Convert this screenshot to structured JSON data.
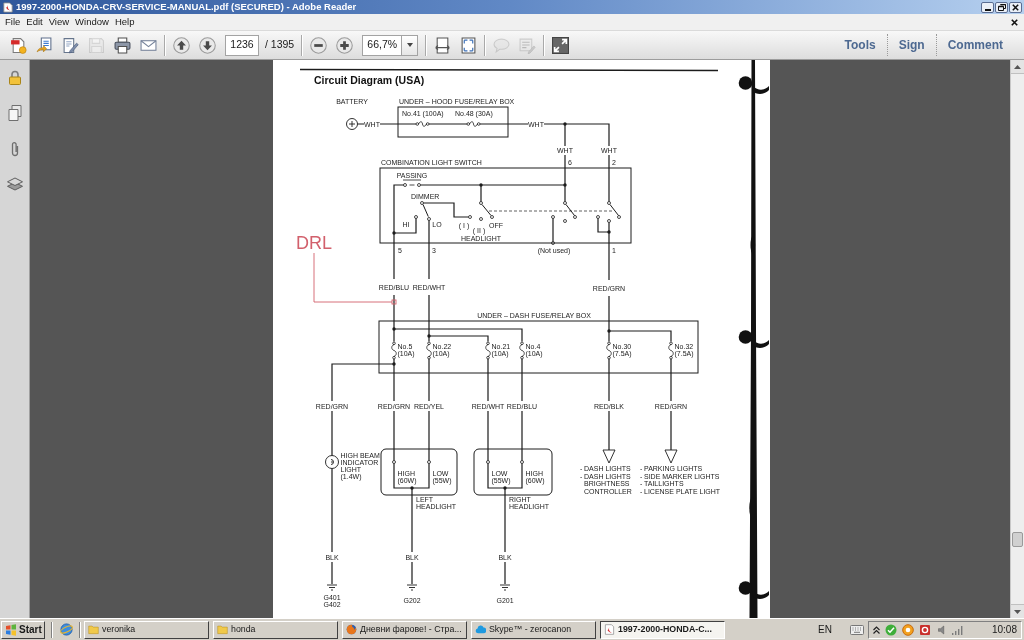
{
  "window": {
    "title": "1997-2000-HONDA-CRV-SERVICE-MANUAL.pdf (SECURED) - Adobe Reader"
  },
  "menu": [
    "File",
    "Edit",
    "View",
    "Window",
    "Help"
  ],
  "toolbar": {
    "groups": [
      [
        {
          "kind": "create",
          "disabled": false
        },
        {
          "kind": "combine",
          "disabled": false
        },
        {
          "kind": "edit",
          "disabled": false
        },
        {
          "kind": "save",
          "disabled": true
        },
        {
          "kind": "print",
          "disabled": false
        },
        {
          "kind": "email",
          "disabled": false
        }
      ],
      [
        {
          "kind": "previous",
          "disabled": false
        },
        {
          "kind": "next",
          "disabled": false
        },
        {
          "kind": "page_field",
          "value": "1236",
          "disabled": false
        },
        {
          "kind": "page_count",
          "text": "/ 1395",
          "disabled": false
        }
      ],
      [
        {
          "kind": "zoom_out",
          "disabled": false
        },
        {
          "kind": "zoom_in",
          "disabled": false
        },
        {
          "kind": "zoom_field",
          "value": "66,7%",
          "disabled": false
        }
      ],
      [
        {
          "kind": "fit_width",
          "disabled": false
        },
        {
          "kind": "fit_page",
          "disabled": false
        }
      ],
      [
        {
          "kind": "comment",
          "disabled": true
        },
        {
          "kind": "highlight",
          "disabled": true
        }
      ],
      [
        {
          "kind": "full_screen",
          "disabled": false
        }
      ]
    ],
    "panels": [
      "Tools",
      "Sign",
      "Comment"
    ]
  },
  "document": {
    "heading": "Circuit Diagram (USA)",
    "annotation": "DRL",
    "battery": "BATTERY",
    "hood_box": {
      "title": "UNDER – HOOD FUSE/RELAY BOX",
      "fuses": [
        "No.41 (100A)",
        "No.48 (30A)"
      ]
    },
    "light_switch": {
      "title": "COMBINATION LIGHT SWITCH",
      "passing": "PASSING",
      "dimmer": "DIMMER",
      "dimmer_positions": [
        "HI",
        "LO"
      ],
      "headlight_positions": [
        "( I )",
        "( II )",
        "OFF"
      ],
      "headlight": "HEADLIGHT",
      "not_used": "(Not used)",
      "pins": [
        "6",
        "2",
        "5",
        "3",
        "1"
      ]
    },
    "dash_box": {
      "title": "UNDER – DASH FUSE/RELAY BOX",
      "fuses": [
        {
          "number": "No.5",
          "rating": "(10A)"
        },
        {
          "number": "No.22",
          "rating": "(10A)"
        },
        {
          "number": "No.21",
          "rating": "(10A)"
        },
        {
          "number": "No.4",
          "rating": "(10A)"
        },
        {
          "number": "No.30",
          "rating": "(7.5A)"
        },
        {
          "number": "No.32",
          "rating": "(7.5A)"
        }
      ]
    },
    "wires": [
      "WHT",
      "WHT",
      "WHT",
      "WHT",
      "RED/BLU",
      "RED/WHT",
      "RED/GRN",
      "RED/GRN",
      "RED/GRN",
      "RED/YEL",
      "RED/WHT",
      "RED/BLU",
      "RED/BLK",
      "RED/GRN",
      "BLK",
      "BLK",
      "BLK"
    ],
    "indicator": [
      "HIGH BEAM",
      "INDICATOR",
      "LIGHT",
      "(1.4W)"
    ],
    "headlights": [
      {
        "name": [
          "LEFT",
          "HEADLIGHT"
        ],
        "bulbs": [
          [
            "HIGH",
            "(60W)"
          ],
          [
            "LOW",
            "(55W)"
          ]
        ]
      },
      {
        "name": [
          "RIGHT",
          "HEADLIGHT"
        ],
        "bulbs": [
          [
            "LOW",
            "(55W)"
          ],
          [
            "HIGH",
            "(60W)"
          ]
        ]
      }
    ],
    "outputs": [
      [
        {
          "bullet": "-",
          "lines": [
            "DASH LIGHTS"
          ]
        },
        {
          "bullet": "-",
          "lines": [
            "DASH LIGHTS",
            "BRIGHTNESS",
            "CONTROLLER"
          ]
        }
      ],
      [
        {
          "bullet": "-",
          "lines": [
            "PARKING LIGHTS"
          ]
        },
        {
          "bullet": "-",
          "lines": [
            "SIDE MARKER LIGHTS"
          ]
        },
        {
          "bullet": "-",
          "lines": [
            "TAILLIGHTS"
          ]
        },
        {
          "bullet": "-",
          "lines": [
            "LICENSE PLATE LIGHT"
          ]
        }
      ]
    ],
    "grounds": [
      [
        "G401",
        "G402"
      ],
      [
        "G202"
      ],
      [
        "G201"
      ]
    ]
  },
  "taskbar": {
    "start": "Start",
    "tasks": [
      {
        "kind": "folder",
        "label": "veronika",
        "selected": false
      },
      {
        "kind": "folder",
        "label": "honda",
        "selected": false
      },
      {
        "kind": "browser",
        "label": "Дневни фарове! - Стра...",
        "selected": false
      },
      {
        "kind": "chat",
        "label": "Skype™ - zerocanon",
        "selected": false
      },
      {
        "kind": "reader",
        "label": "1997-2000-HONDA-C...",
        "selected": true
      }
    ],
    "language": "EN",
    "clock": "10:08"
  }
}
